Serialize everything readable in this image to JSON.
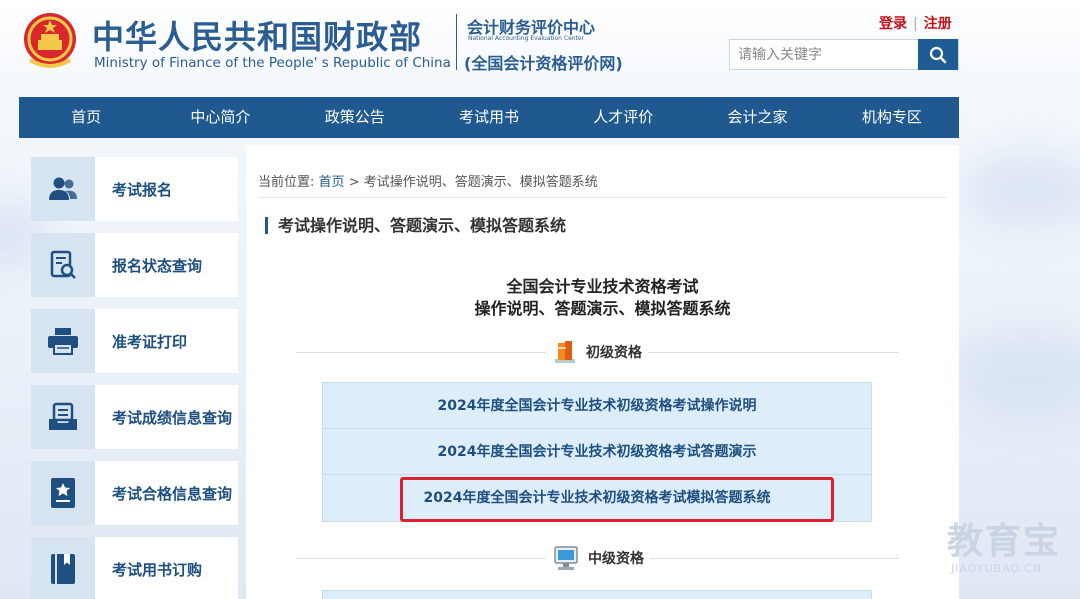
{
  "header": {
    "ministry_cn": "中华人民共和国财政部",
    "ministry_en": "Ministry of Finance of the People' s Republic of China",
    "center_cn": "会计财务评价中心",
    "center_en": "National Accounting Evaluation Center",
    "center_sub": "(全国会计资格评价网)",
    "login": "登录",
    "register": "注册",
    "search_placeholder": "请输入关键字"
  },
  "nav": [
    "首页",
    "中心简介",
    "政策公告",
    "考试用书",
    "人才评价",
    "会计之家",
    "机构专区"
  ],
  "sidebar": [
    {
      "label": "考试报名",
      "icon": "users-icon"
    },
    {
      "label": "报名状态查询",
      "icon": "document-search-icon"
    },
    {
      "label": "准考证打印",
      "icon": "printer-icon"
    },
    {
      "label": "考试成绩信息查询",
      "icon": "score-tray-icon"
    },
    {
      "label": "考试合格信息查询",
      "icon": "certificate-icon"
    },
    {
      "label": "考试用书订购",
      "icon": "book-icon"
    }
  ],
  "breadcrumb": {
    "prefix": "当前位置:",
    "home": "首页",
    "separator": ">",
    "current": "考试操作说明、答题演示、模拟答题系统"
  },
  "section_title": "考试操作说明、答题演示、模拟答题系统",
  "heading_line1": "全国会计专业技术资格考试",
  "heading_line2": "操作说明、答题演示、模拟答题系统",
  "levels": [
    {
      "label": "初级资格",
      "icon": "books-icon",
      "links": [
        "2024年度全国会计专业技术初级资格考试操作说明",
        "2024年度全国会计专业技术初级资格考试答题演示",
        "2024年度全国会计专业技术初级资格考试模拟答题系统"
      ]
    },
    {
      "label": "中级资格",
      "icon": "computer-icon",
      "links": []
    }
  ],
  "watermark": {
    "cn": "教育宝",
    "en": "JIAOYUBAO.CN"
  },
  "colors": {
    "brand": "#1f5990",
    "highlight": "#e0202a",
    "auth": "#c0121b"
  }
}
